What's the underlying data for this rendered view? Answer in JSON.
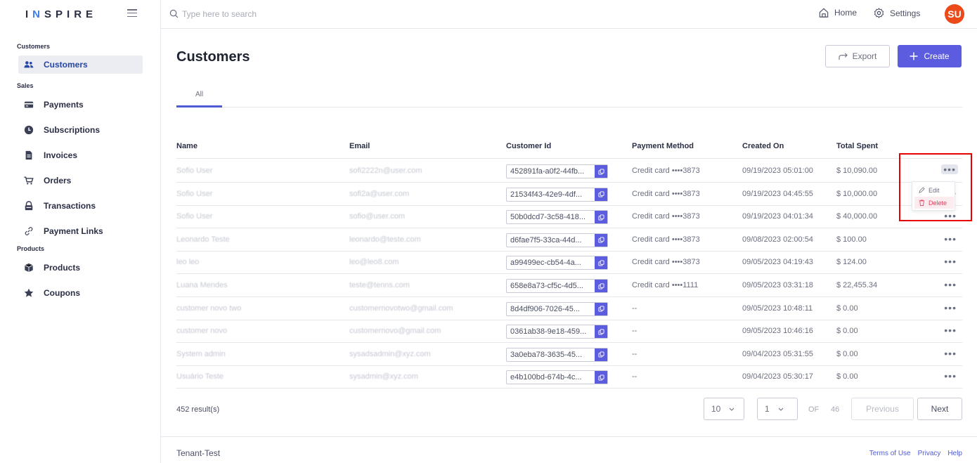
{
  "app": {
    "logo": "INSPIRE"
  },
  "search": {
    "placeholder": "Type here to search"
  },
  "header": {
    "home": "Home",
    "settings": "Settings",
    "avatar": "SU"
  },
  "sidebar": {
    "sections": [
      {
        "title": "Customers"
      },
      {
        "title": "Sales"
      },
      {
        "title": "Products"
      }
    ],
    "items": [
      {
        "label": "Customers",
        "icon": "users-icon"
      },
      {
        "label": "Payments",
        "icon": "credit-card-icon"
      },
      {
        "label": "Subscriptions",
        "icon": "clock-icon"
      },
      {
        "label": "Invoices",
        "icon": "document-icon"
      },
      {
        "label": "Orders",
        "icon": "cart-icon"
      },
      {
        "label": "Transactions",
        "icon": "lock-icon"
      },
      {
        "label": "Payment Links",
        "icon": "link-icon"
      },
      {
        "label": "Products",
        "icon": "box-icon"
      },
      {
        "label": "Coupons",
        "icon": "star-icon"
      }
    ]
  },
  "main": {
    "title": "Customers",
    "export_label": "Export",
    "create_label": "Create",
    "tab_all": "All",
    "columns": [
      "Name",
      "Email",
      "Customer Id",
      "Payment Method",
      "Created On",
      "Total Spent"
    ],
    "rows": [
      {
        "name": "Sofio User",
        "email": "sofi2222n@user.com",
        "customer_id": "452891fa-a0f2-44fb...",
        "payment": "Credit card ••••3873",
        "created": "09/19/2023 05:01:00",
        "total": "$ 10,090.00"
      },
      {
        "name": "Sofio User",
        "email": "sofi2a@user.com",
        "customer_id": "21534f43-42e9-4df...",
        "payment": "Credit card ••••3873",
        "created": "09/19/2023 04:45:55",
        "total": "$ 10,000.00"
      },
      {
        "name": "Sofio User",
        "email": "sofio@user.com",
        "customer_id": "50b0dcd7-3c58-418...",
        "payment": "Credit card ••••3873",
        "created": "09/19/2023 04:01:34",
        "total": "$ 40,000.00"
      },
      {
        "name": "Leonardo Teste",
        "email": "leonardo@teste.com",
        "customer_id": "d6fae7f5-33ca-44d...",
        "payment": "Credit card ••••3873",
        "created": "09/08/2023 02:00:54",
        "total": "$ 100.00"
      },
      {
        "name": "leo leo",
        "email": "leo@leo8.com",
        "customer_id": "a99499ec-cb54-4a...",
        "payment": "Credit card ••••3873",
        "created": "09/05/2023 04:19:43",
        "total": "$ 124.00"
      },
      {
        "name": "Luana Mendes",
        "email": "teste@tenns.com",
        "customer_id": "658e8a73-cf5c-4d5...",
        "payment": "Credit card ••••1111",
        "created": "09/05/2023 03:31:18",
        "total": "$ 22,455.34"
      },
      {
        "name": "customer novo two",
        "email": "customernovotwo@gmail.com",
        "customer_id": "8d4df906-7026-45...",
        "payment": "--",
        "created": "09/05/2023 10:48:11",
        "total": "$ 0.00"
      },
      {
        "name": "customer novo",
        "email": "customernovo@gmail.com",
        "customer_id": "0361ab38-9e18-459...",
        "payment": "--",
        "created": "09/05/2023 10:46:16",
        "total": "$ 0.00"
      },
      {
        "name": "System admin",
        "email": "sysadsadmin@xyz.com",
        "customer_id": "3a0eba78-3635-45...",
        "payment": "--",
        "created": "09/04/2023 05:31:55",
        "total": "$ 0.00"
      },
      {
        "name": "Usuário Teste",
        "email": "sysadmin@xyz.com",
        "customer_id": "e4b100bd-674b-4c...",
        "payment": "--",
        "created": "09/04/2023 05:30:17",
        "total": "$ 0.00"
      }
    ],
    "menu": {
      "edit": "Edit",
      "delete": "Delete"
    }
  },
  "pagination": {
    "results": "452 result(s)",
    "page_size": "10",
    "page": "1",
    "of_label": "OF",
    "total_pages": "46",
    "previous": "Previous",
    "next": "Next"
  },
  "footer": {
    "tenant": "Tenant-Test",
    "terms": "Terms of Use",
    "privacy": "Privacy",
    "help": "Help"
  },
  "colors": {
    "accent": "#5b5ce0",
    "avatar": "#ec4a19",
    "delete": "#e23b5a",
    "highlight": "#e60000"
  }
}
